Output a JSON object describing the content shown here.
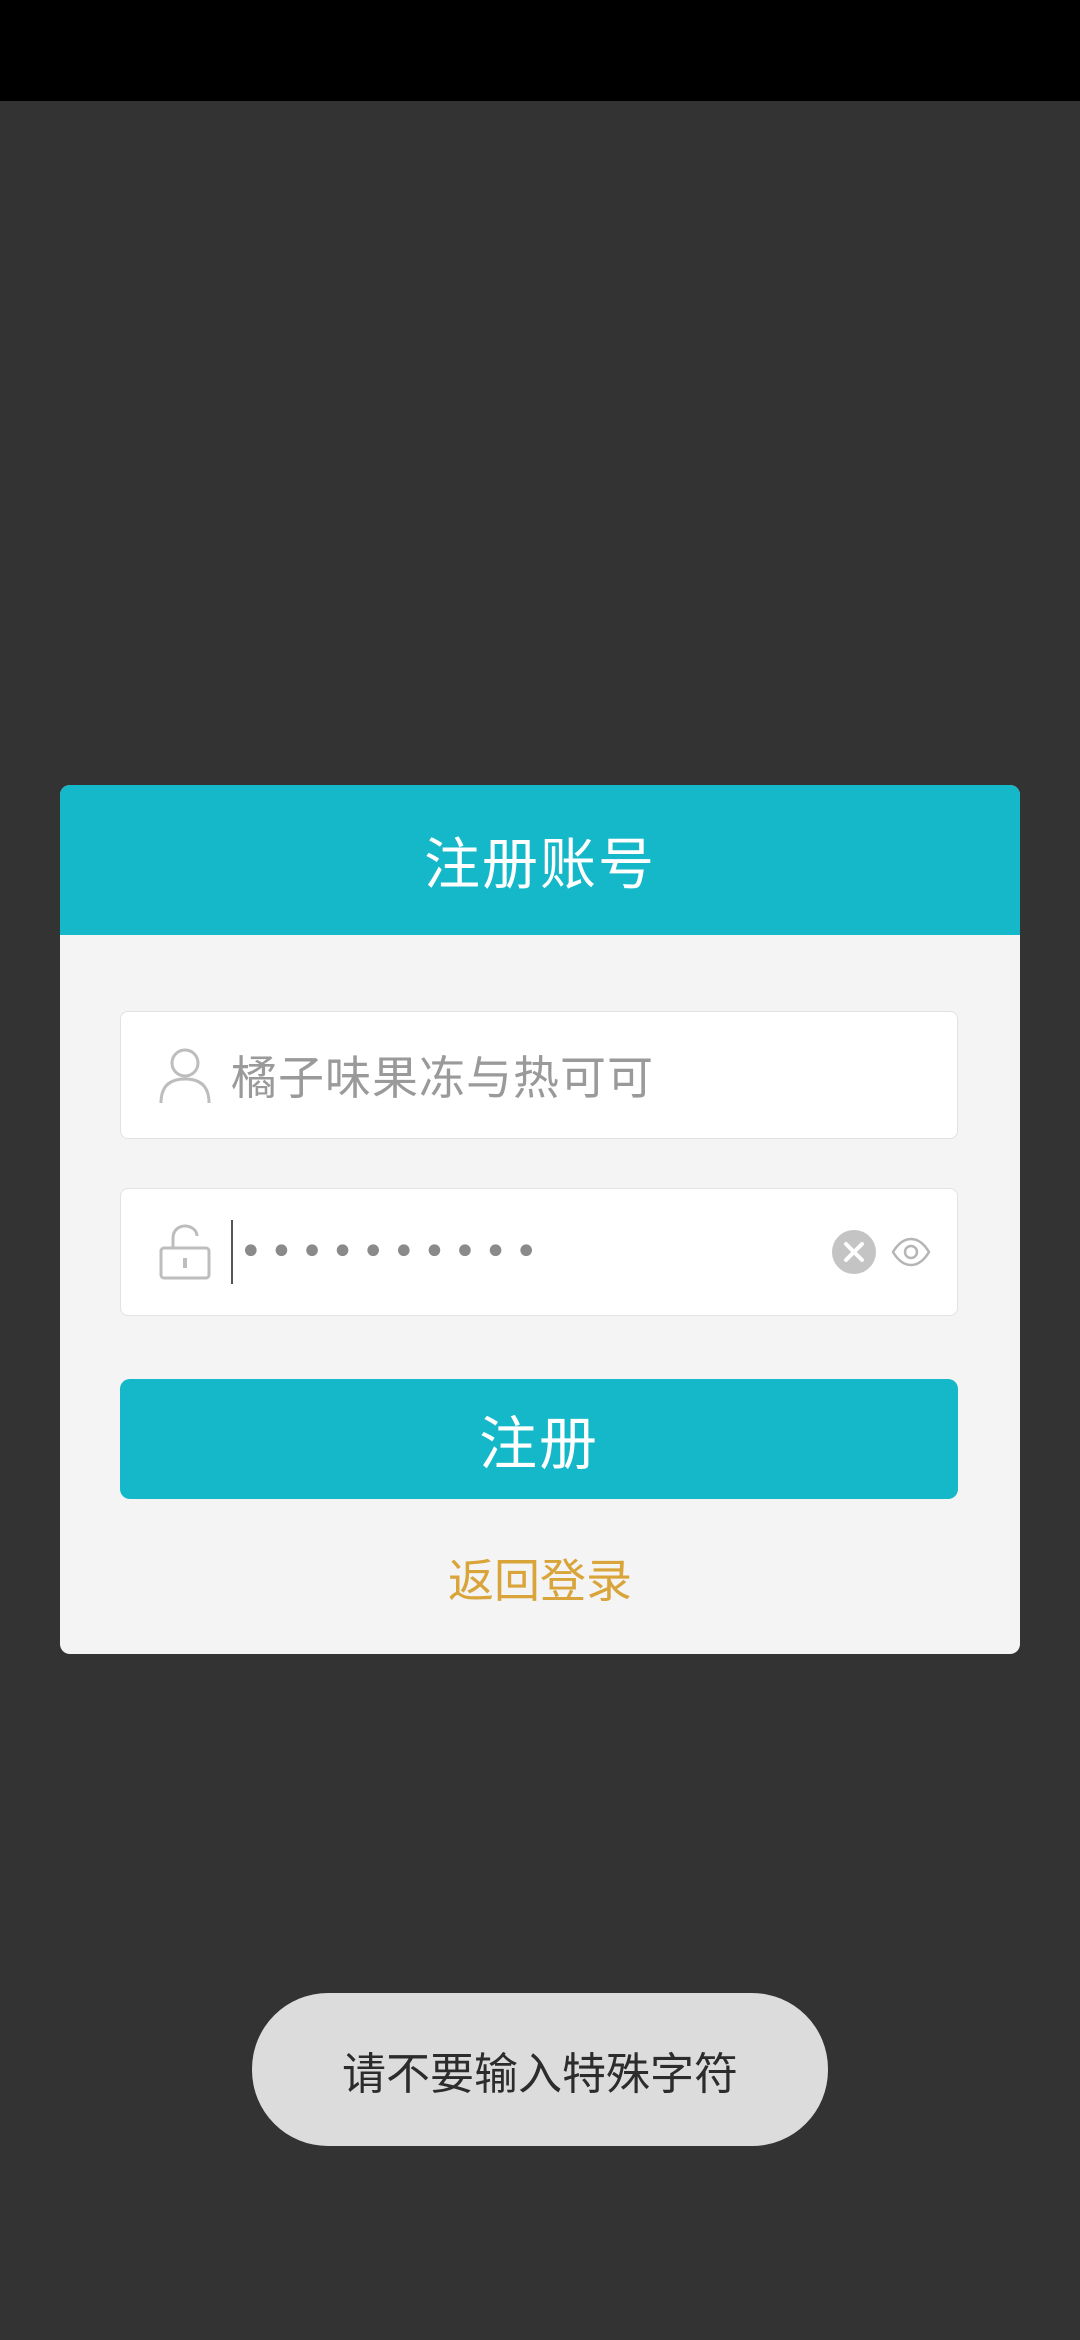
{
  "dialog": {
    "title": "注册账号",
    "username": {
      "value": "橘子味果冻与热可可",
      "icon": "user-icon"
    },
    "password": {
      "masked_value": "••••••••••",
      "icon": "unlock-icon",
      "clear_icon": "clear-icon",
      "visibility_icon": "eye-icon"
    },
    "register_label": "注册",
    "back_to_login_label": "返回登录"
  },
  "toast": {
    "message": "请不要输入特殊字符"
  },
  "colors": {
    "accent": "#14b8c8",
    "link": "#d9a43a",
    "background": "#333333"
  }
}
